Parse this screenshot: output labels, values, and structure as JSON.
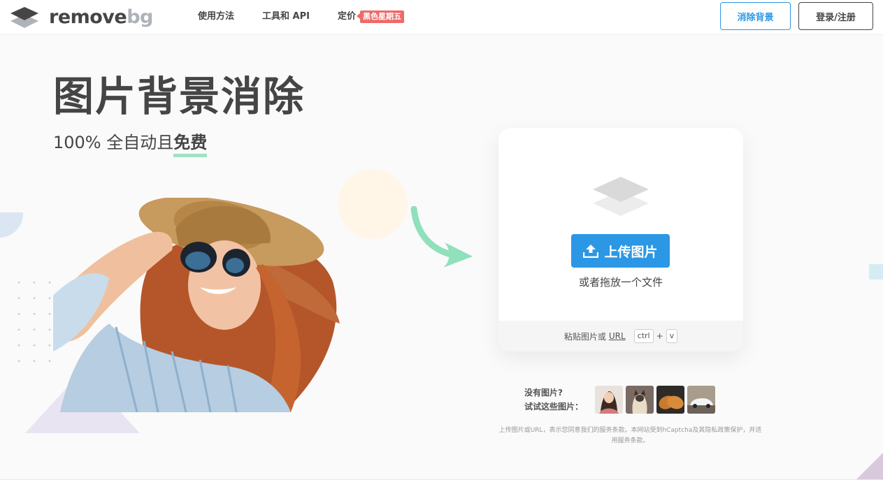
{
  "header": {
    "logo_text_remove": "remove",
    "logo_text_bg": "bg",
    "nav": [
      {
        "label": "使用方法"
      },
      {
        "label": "工具和 API"
      },
      {
        "label": "定价",
        "badge": "黑色星期五"
      }
    ],
    "remove_bg_button": "消除背景",
    "login_button": "登录/注册"
  },
  "hero": {
    "title": "图片背景消除",
    "subtitle_prefix": "100% 全自动且",
    "subtitle_highlight": "免费"
  },
  "upload": {
    "button_label": "上传图片",
    "drop_text": "或者拖放一个文件",
    "paste_prefix": "粘贴图片或",
    "paste_url": "URL",
    "key_ctrl": "ctrl",
    "key_plus": "+",
    "key_v": "v"
  },
  "samples": {
    "line1": "没有图片?",
    "line2": "试试这些图片：",
    "items": [
      "woman-icon",
      "cat-icon",
      "bread-icon",
      "car-icon"
    ]
  },
  "disclaimer": "上传图片或URL，表示您同意我们的服务条款。本网站受到hCaptcha及其隐私政策保护，并适用服务条款。",
  "colors": {
    "accent": "#2b97e5",
    "badge": "#ef6a6a",
    "highlight": "#9ee4c4",
    "text": "#454545"
  }
}
